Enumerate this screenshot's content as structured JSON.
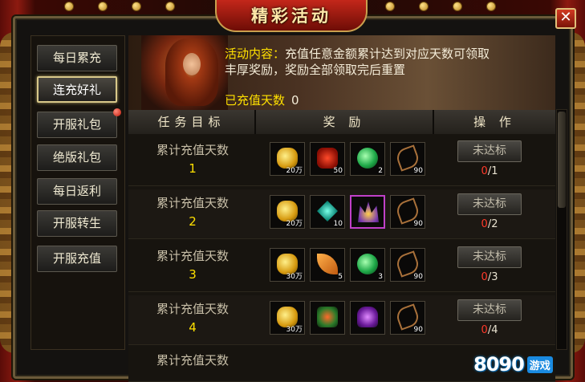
{
  "window": {
    "title": "精彩活动",
    "close_glyph": "✕"
  },
  "sidebar": {
    "items": [
      {
        "label": "每日累充",
        "active": false,
        "badge": false
      },
      {
        "label": "连充好礼",
        "active": true,
        "badge": false
      },
      {
        "label": "开服礼包",
        "active": false,
        "badge": true
      },
      {
        "label": "绝版礼包",
        "active": false,
        "badge": false
      },
      {
        "label": "每日返利",
        "active": false,
        "badge": false
      },
      {
        "label": "开服转生",
        "active": false,
        "badge": false
      },
      {
        "label": "开服充值",
        "active": false,
        "badge": false
      }
    ]
  },
  "banner": {
    "content_label": "活动内容：",
    "content_text_1": "充值任意金额累计达到对应天数可领取",
    "content_text_2": "丰厚奖励，奖励全部领取完后重置",
    "days_label": "已充值天数",
    "days_value": "0"
  },
  "table": {
    "headers": {
      "target": "任务目标",
      "reward": "奖 励",
      "action": "操 作"
    },
    "rows": [
      {
        "target_label": "累计充值天数",
        "target_num": "1",
        "rewards": [
          {
            "icon": "gold-ingot-icon",
            "glyph": "g-gold",
            "qty": "20万",
            "rare": false
          },
          {
            "icon": "red-gem-icon",
            "glyph": "g-red",
            "qty": "50",
            "rare": false
          },
          {
            "icon": "green-potion-icon",
            "glyph": "g-green",
            "qty": "2",
            "rare": false
          },
          {
            "icon": "bow-icon",
            "glyph": "g-bow",
            "qty": "90",
            "rare": false
          }
        ],
        "button": "未达标",
        "progress_cur": "0",
        "progress_total": "/1"
      },
      {
        "target_label": "累计充值天数",
        "target_num": "2",
        "rewards": [
          {
            "icon": "gold-ingot-icon",
            "glyph": "g-gold",
            "qty": "20万",
            "rare": false
          },
          {
            "icon": "teal-crystal-icon",
            "glyph": "g-teal",
            "qty": "10",
            "rare": false
          },
          {
            "icon": "crown-icon",
            "glyph": "g-crown",
            "qty": "",
            "rare": true
          },
          {
            "icon": "bow-icon",
            "glyph": "g-bow",
            "qty": "90",
            "rare": false
          }
        ],
        "button": "未达标",
        "progress_cur": "0",
        "progress_total": "/2"
      },
      {
        "target_label": "累计充值天数",
        "target_num": "3",
        "rewards": [
          {
            "icon": "gold-ingot-icon",
            "glyph": "g-gold",
            "qty": "30万",
            "rare": false
          },
          {
            "icon": "orange-feather-icon",
            "glyph": "g-leaf",
            "qty": "5",
            "rare": false
          },
          {
            "icon": "green-potion-icon",
            "glyph": "g-green",
            "qty": "3",
            "rare": false
          },
          {
            "icon": "bow-icon",
            "glyph": "g-bow",
            "qty": "90",
            "rare": false
          }
        ],
        "button": "未达标",
        "progress_cur": "0",
        "progress_total": "/3"
      },
      {
        "target_label": "累计充值天数",
        "target_num": "4",
        "rewards": [
          {
            "icon": "gold-ingot-icon",
            "glyph": "g-gold",
            "qty": "30万",
            "rare": false
          },
          {
            "icon": "armor-icon",
            "glyph": "g-armor",
            "qty": "",
            "rare": false
          },
          {
            "icon": "purple-helmet-icon",
            "glyph": "g-helm",
            "qty": "",
            "rare": false
          },
          {
            "icon": "bow-icon",
            "glyph": "g-bow",
            "qty": "90",
            "rare": false
          }
        ],
        "button": "未达标",
        "progress_cur": "0",
        "progress_total": "/4"
      }
    ],
    "partial_row_label": "累计充值天数"
  },
  "watermark": {
    "brand": "8090",
    "suffix": "游戏"
  }
}
